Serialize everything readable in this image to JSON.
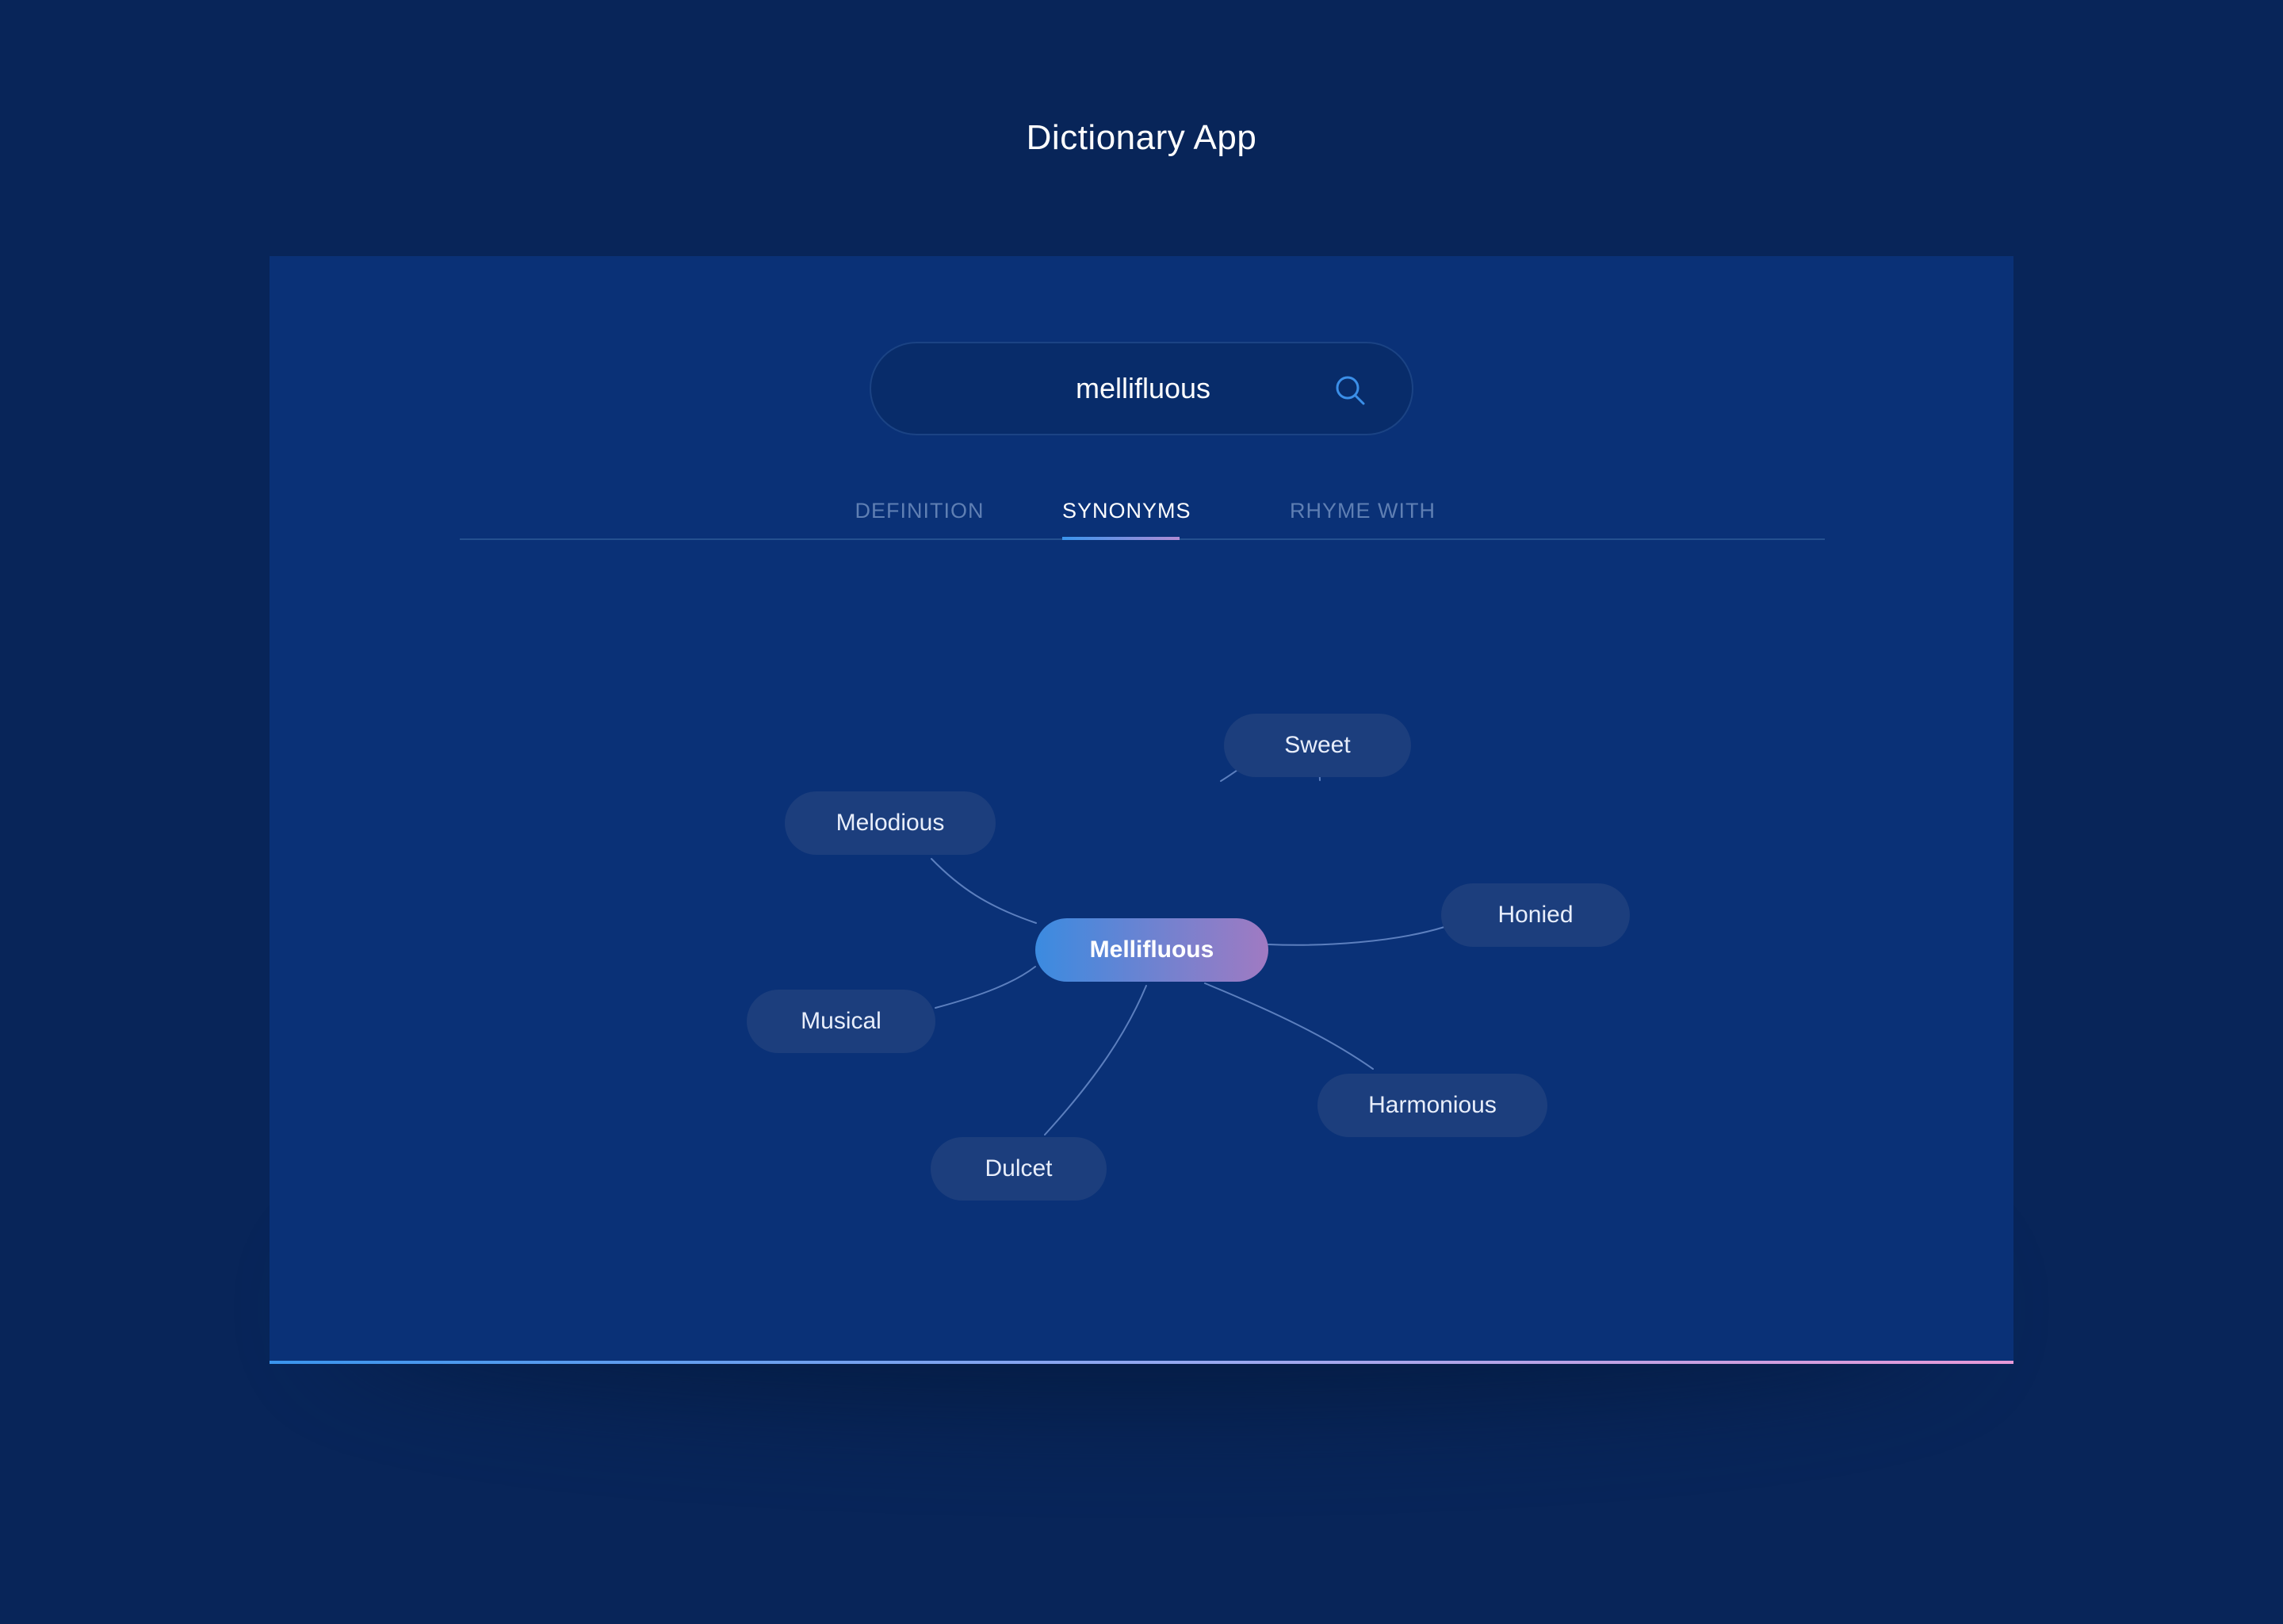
{
  "app": {
    "title": "Dictionary App"
  },
  "search": {
    "value": "mellifluous",
    "icon": "search-icon"
  },
  "tabs": [
    {
      "label": "DEFINITION",
      "active": false
    },
    {
      "label": "SYNONYMS",
      "active": true
    },
    {
      "label": "RHYME WITH",
      "active": false
    }
  ],
  "graph": {
    "center": "Mellifluous",
    "synonyms": [
      "Sweet",
      "Melodious",
      "Honied",
      "Musical",
      "Harmonious",
      "Dulcet"
    ]
  },
  "colors": {
    "background": "#082559",
    "panel": "#0a3177",
    "node": "#1c3e7d",
    "accent_start": "#3a95ee",
    "accent_end": "#e79ad8"
  }
}
